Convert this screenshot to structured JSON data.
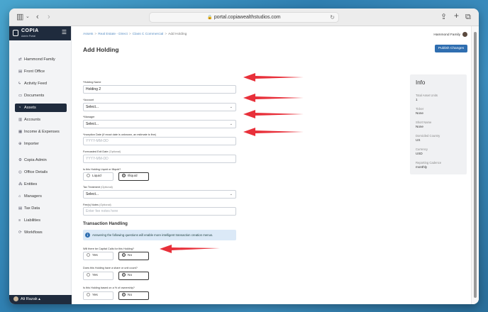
{
  "browser": {
    "url": "portal.copiawealthstudios.com"
  },
  "brand": {
    "name": "COPIA",
    "subtitle": "Admin Portal"
  },
  "nav": [
    {
      "label": "Hammond Family",
      "icon": "swap-icon",
      "glyph": "⇄"
    },
    {
      "label": "Front Office",
      "icon": "building-icon",
      "glyph": "▤"
    },
    {
      "label": "Activity Feed",
      "icon": "activity-icon",
      "glyph": "ϟ"
    },
    {
      "label": "Documents",
      "icon": "document-icon",
      "glyph": "▭"
    },
    {
      "label": "Assets",
      "icon": "assets-icon",
      "glyph": "◔"
    },
    {
      "label": "Accounts",
      "icon": "accounts-icon",
      "glyph": "▥"
    },
    {
      "label": "Income & Expenses",
      "icon": "income-icon",
      "glyph": "▦"
    },
    {
      "label": "Importer",
      "icon": "importer-icon",
      "glyph": "⊕"
    },
    {
      "label": "Copia Admin",
      "icon": "gear-icon",
      "glyph": "⚙"
    },
    {
      "label": "Office Details",
      "icon": "office-icon",
      "glyph": "◎"
    },
    {
      "label": "Entities",
      "icon": "entities-icon",
      "glyph": "⁂"
    },
    {
      "label": "Managers",
      "icon": "managers-icon",
      "glyph": "⌂"
    },
    {
      "label": "Tax Data",
      "icon": "tax-icon",
      "glyph": "▤"
    },
    {
      "label": "Liabilities",
      "icon": "liabilities-icon",
      "glyph": "≡"
    },
    {
      "label": "Workflows",
      "icon": "workflow-icon",
      "glyph": "⟳"
    }
  ],
  "user": {
    "name": "Ali Razak ▴"
  },
  "breadcrumb": {
    "b0": "Assets",
    "b1": "Real Estate - Direct",
    "b2": "Class C Commercial",
    "b3": "Add Holding",
    "sep": ">"
  },
  "account": {
    "name": "Hammond Family"
  },
  "page": {
    "title": "Add Holding",
    "publish": "Publish Changes"
  },
  "form": {
    "holding_name_label": "*Holding Name",
    "holding_name_value": "Holding 2",
    "account_label": "*Account",
    "account_value": "Select...",
    "manager_label": "*Manager",
    "manager_value": "Select...",
    "inception_label": "*Inception Date (If exact date is unknown, an estimate is fine)",
    "inception_placeholder": "YYYY-MM-DD",
    "exit_label": "Forecasted Exit Date",
    "exit_opt": "(Optional)",
    "exit_placeholder": "YYYY-MM-DD",
    "liquid_q": "Is this Holding Liquid or Illiquid?",
    "liquid": "Liquid",
    "illiquid": "Illiquid",
    "tax_label": "Tax Treatment",
    "tax_opt": "(Optional)",
    "tax_value": "Select...",
    "notes_label": "Fee(s) Notes",
    "notes_opt": "(Optional)",
    "notes_placeholder": "Enter fee notes here"
  },
  "txn": {
    "title": "Transaction Handling",
    "banner": "Answering the following questions will enable more intelligent transaction creation menus.",
    "q1": "Will there be Capital Calls for this Holding?",
    "q2": "Does this Holding have a share or unit count?",
    "q3": "Is this Holding based on a % of ownership?",
    "yes": "Yes",
    "no": "No"
  },
  "info": {
    "title": "Info",
    "rows": [
      {
        "k": "Total Asset Units",
        "v": "1"
      },
      {
        "k": "Ticker",
        "v": "None"
      },
      {
        "k": "Short Name",
        "v": "None"
      },
      {
        "k": "Domiciled Country",
        "v": "US"
      },
      {
        "k": "Currency",
        "v": "USD"
      },
      {
        "k": "Reporting Cadence",
        "v": "monthly"
      }
    ]
  },
  "colors": {
    "arrow": "#e8303a",
    "primary": "#2f6eb0",
    "sidebar_dark": "#1f2b3d"
  }
}
